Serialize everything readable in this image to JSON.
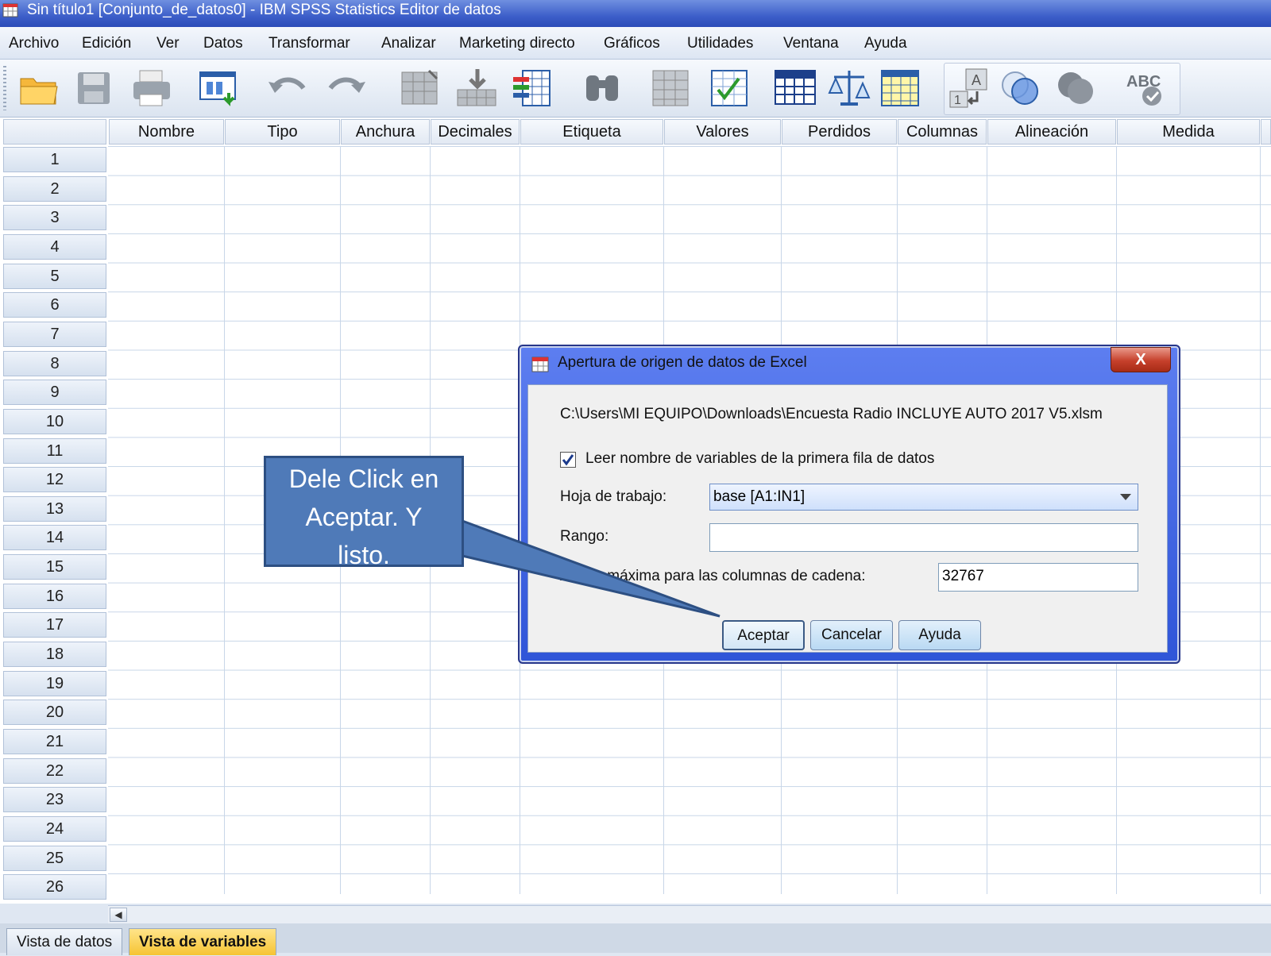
{
  "window": {
    "title": "Sin título1 [Conjunto_de_datos0] - IBM SPSS Statistics Editor de datos"
  },
  "menu": [
    "Archivo",
    "Edición",
    "Ver",
    "Datos",
    "Transformar",
    "Analizar",
    "Marketing directo",
    "Gráficos",
    "Utilidades",
    "Ventana",
    "Ayuda"
  ],
  "toolbar": {
    "icons": [
      "open-folder-icon",
      "save-icon",
      "print-icon",
      "recall-dialog-icon",
      "undo-icon",
      "redo-icon",
      "goto-case-icon",
      "goto-variable-icon",
      "variables-icon",
      "find-icon",
      "insert-cases-icon",
      "insert-variable-icon",
      "split-file-icon",
      "weight-cases-icon",
      "select-cases-icon",
      "value-labels-icon",
      "use-sets-icon",
      "show-all-variables-icon",
      "spell-check-icon"
    ],
    "spell_label": "ABC"
  },
  "grid": {
    "columns": [
      "Nombre",
      "Tipo",
      "Anchura",
      "Decimales",
      "Etiqueta",
      "Valores",
      "Perdidos",
      "Columnas",
      "Alineación",
      "Medida"
    ],
    "rows": [
      "1",
      "2",
      "3",
      "4",
      "5",
      "6",
      "7",
      "8",
      "9",
      "10",
      "11",
      "12",
      "13",
      "14",
      "15",
      "16",
      "17",
      "18",
      "19",
      "20",
      "21",
      "22",
      "23",
      "24",
      "25",
      "26"
    ]
  },
  "tabs": {
    "data_view": "Vista de datos",
    "variable_view": "Vista de variables"
  },
  "dialog": {
    "title": "Apertura de origen de datos de Excel",
    "path": "C:\\Users\\MI EQUIPO\\Downloads\\Encuesta Radio INCLUYE AUTO 2017 V5.xlsm",
    "read_names_label": "Leer nombre de variables de la primera fila de datos",
    "read_names_checked": true,
    "sheet_label": "Hoja de trabajo:",
    "sheet_value": "base [A1:IN1]",
    "range_label": "Rango:",
    "range_value": "",
    "maxwidth_label_visible": "máxima para las columnas de cadena:",
    "maxwidth_label_prefix": "An",
    "maxwidth_value": "32767",
    "ok_label": "Aceptar",
    "cancel_label": "Cancelar",
    "help_label": "Ayuda",
    "close_label": "X"
  },
  "callout": {
    "line1": "Dele Click en",
    "line2": "Aceptar. Y",
    "line3": "listo."
  },
  "colors": {
    "callout": "#4f7ab8",
    "active_tab": "#f6c433",
    "dialog_frame": "#3d5fd8"
  }
}
